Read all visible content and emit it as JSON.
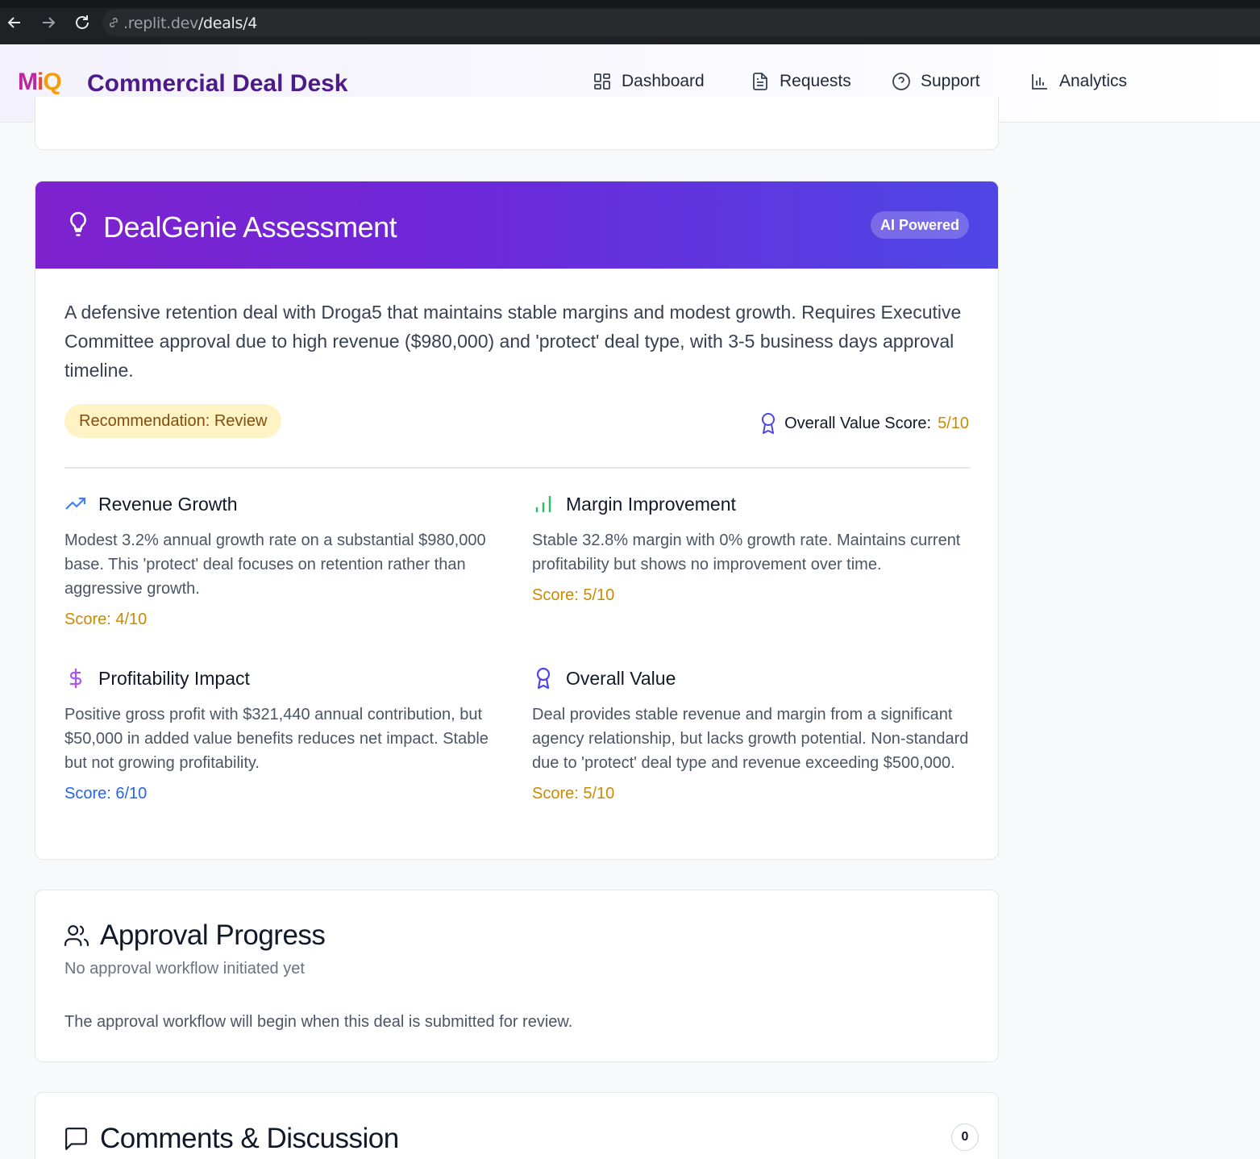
{
  "browser": {
    "url_host": ".replit.dev",
    "url_path": "/deals/4"
  },
  "header": {
    "logo_text": "MiQ",
    "app_title": "Commercial Deal Desk",
    "nav": [
      {
        "label": "Dashboard",
        "icon": "grid-icon"
      },
      {
        "label": "Requests",
        "icon": "document-icon"
      },
      {
        "label": "Support",
        "icon": "help-circle-icon"
      },
      {
        "label": "Analytics",
        "icon": "bar-chart-icon"
      }
    ]
  },
  "assessment": {
    "title": "DealGenie Assessment",
    "badge": "AI Powered",
    "summary": "A defensive retention deal with Droga5 that maintains stable margins and modest growth. Requires Executive Committee approval due to high revenue ($980,000) and 'protect' deal type, with 3-5 business days approval timeline.",
    "recommendation": "Recommendation: Review",
    "overall_label": "Overall Value Score:",
    "overall_value": "5/10",
    "metrics": [
      {
        "title": "Revenue Growth",
        "description": "Modest 3.2% annual growth rate on a substantial $980,000 base. This 'protect' deal focuses on retention rather than aggressive growth.",
        "score": "Score: 4/10",
        "icon": "trending-up-icon"
      },
      {
        "title": "Margin Improvement",
        "description": "Stable 32.8% margin with 0% growth rate. Maintains current profitability but shows no improvement over time.",
        "score": "Score: 5/10",
        "icon": "signal-bars-icon"
      },
      {
        "title": "Profitability Impact",
        "description": "Positive gross profit with $321,440 annual contribution, but $50,000 in added value benefits reduces net impact. Stable but not growing profitability.",
        "score": "Score: 6/10",
        "icon": "dollar-icon"
      },
      {
        "title": "Overall Value",
        "description": "Deal provides stable revenue and margin from a significant agency relationship, but lacks growth potential. Non-standard due to 'protect' deal type and revenue exceeding $500,000.",
        "score": "Score: 5/10",
        "icon": "award-icon"
      }
    ]
  },
  "approval": {
    "title": "Approval Progress",
    "subtitle": "No approval workflow initiated yet",
    "note": "The approval workflow will begin when this deal is submitted for review."
  },
  "comments": {
    "title": "Comments & Discussion",
    "count": "0"
  },
  "colors": {
    "brand_purple": "#4c1a8a",
    "gradient_start": "#7e22ce",
    "gradient_end": "#4f46e5",
    "score_amber": "#ca8a04",
    "score_blue": "#2563eb"
  }
}
